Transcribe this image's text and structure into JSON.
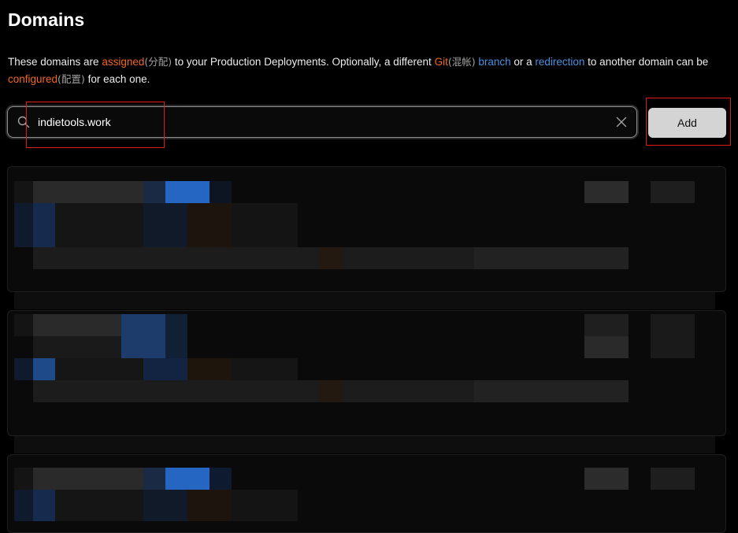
{
  "page": {
    "title": "Domains"
  },
  "description": {
    "part1": "These domains are ",
    "assigned": "assigned",
    "assigned_cjk": "(分配)",
    "part2": " to your Production Deployments. Optionally, a different ",
    "git": "Git",
    "git_cjk": "(混帐)",
    "branch": " branch",
    "part3": " or a ",
    "redirection": "redirection",
    "part4": " to another domain can be ",
    "configured": "configured",
    "configured_cjk": "(配置)",
    "part5": " for each one."
  },
  "search": {
    "value": "indietools.work",
    "placeholder": ""
  },
  "add_button": {
    "label": "Add"
  },
  "colors": {
    "accent_orange": "#f0671f",
    "link_blue": "#4a90e2",
    "annotation_red": "#e0191b",
    "button_bg": "#d4d4d4"
  },
  "icons": {
    "search": "search-icon",
    "clear": "close-icon"
  },
  "domain_cards": [
    {
      "note": "pixelated"
    },
    {
      "note": "pixelated"
    },
    {
      "note": "pixelated"
    }
  ]
}
